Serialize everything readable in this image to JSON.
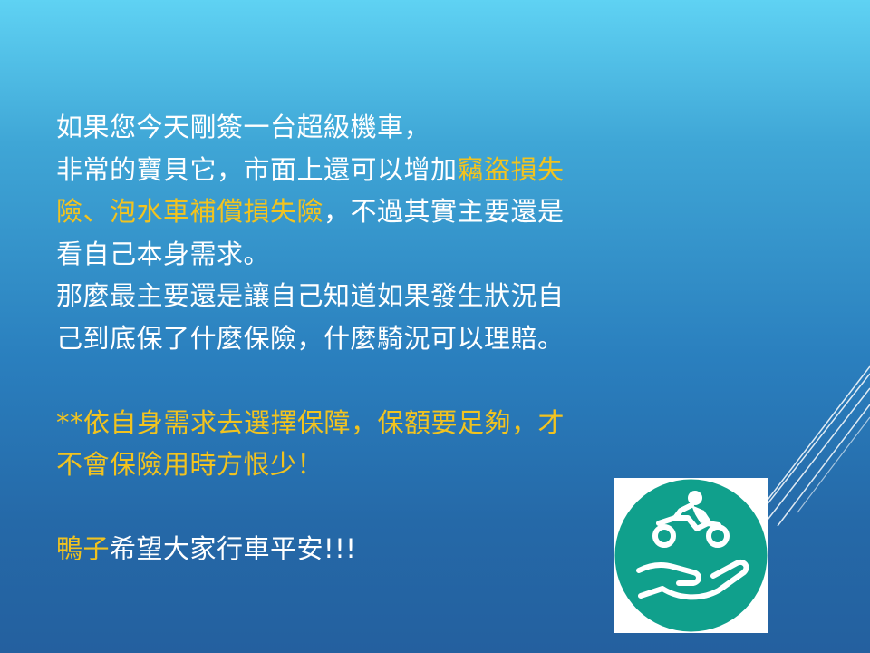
{
  "slide": {
    "paragraph1": {
      "line1": "如果您今天剛簽一台超級機車，",
      "line2_a": "非常的寶貝它，市面上還可以增加",
      "line2_b": "竊盜損失",
      "line3_a": "險、泡水車補償損失險",
      "line3_b": "，不過其實主要還是",
      "line4": "看自己本身需求。"
    },
    "paragraph2": {
      "line1": "那麼最主要還是讓自己知道如果發生狀況自",
      "line2": "己到底保了什麼保險，什麼騎況可以理賠。"
    },
    "tip": {
      "line1": "**依自身需求去選擇保障，保額要足夠，才",
      "line2": "不會保險用時方恨少！"
    },
    "closing": {
      "name": "鴨子",
      "message": "希望大家行車平安!!!"
    },
    "icon": {
      "name": "motorcycle-insurance-hand-icon",
      "circle_color": "#10a08c",
      "line_color": "#ffffff"
    },
    "colors": {
      "text": "#ffffff",
      "highlight": "#f2c31f",
      "background_top": "#5fd2f3",
      "background_bottom": "#24609f"
    }
  }
}
